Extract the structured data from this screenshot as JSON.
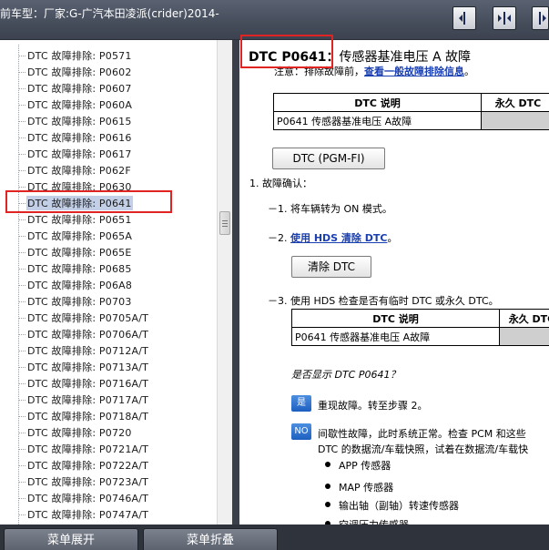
{
  "window": {
    "title": "前车型：厂家:G-广汽本田凌派(crider)2014-"
  },
  "toolbar": {
    "buttons": [
      "collapse-left-icon",
      "split-view-icon",
      "expand-right-icon"
    ]
  },
  "tree": {
    "items": [
      {
        "label": "DTC 故障排除: P0571",
        "selected": false
      },
      {
        "label": "DTC 故障排除: P0602",
        "selected": false
      },
      {
        "label": "DTC 故障排除: P0607",
        "selected": false
      },
      {
        "label": "DTC 故障排除: P060A",
        "selected": false
      },
      {
        "label": "DTC 故障排除: P0615",
        "selected": false
      },
      {
        "label": "DTC 故障排除: P0616",
        "selected": false
      },
      {
        "label": "DTC 故障排除: P0617",
        "selected": false
      },
      {
        "label": "DTC 故障排除: P062F",
        "selected": false
      },
      {
        "label": "DTC 故障排除: P0630",
        "selected": false
      },
      {
        "label": "DTC 故障排除: P0641",
        "selected": true
      },
      {
        "label": "DTC 故障排除: P0651",
        "selected": false
      },
      {
        "label": "DTC 故障排除: P065A",
        "selected": false
      },
      {
        "label": "DTC 故障排除: P065E",
        "selected": false
      },
      {
        "label": "DTC 故障排除: P0685",
        "selected": false
      },
      {
        "label": "DTC 故障排除: P06A8",
        "selected": false
      },
      {
        "label": "DTC 故障排除: P0703",
        "selected": false
      },
      {
        "label": "DTC 故障排除: P0705A/T",
        "selected": false
      },
      {
        "label": "DTC 故障排除: P0706A/T",
        "selected": false
      },
      {
        "label": "DTC 故障排除: P0712A/T",
        "selected": false
      },
      {
        "label": "DTC 故障排除: P0713A/T",
        "selected": false
      },
      {
        "label": "DTC 故障排除: P0716A/T",
        "selected": false
      },
      {
        "label": "DTC 故障排除: P0717A/T",
        "selected": false
      },
      {
        "label": "DTC 故障排除: P0718A/T",
        "selected": false
      },
      {
        "label": "DTC 故障排除: P0720",
        "selected": false
      },
      {
        "label": "DTC 故障排除: P0721A/T",
        "selected": false
      },
      {
        "label": "DTC 故障排除: P0722A/T",
        "selected": false
      },
      {
        "label": "DTC 故障排除: P0723A/T",
        "selected": false
      },
      {
        "label": "DTC 故障排除: P0746A/T",
        "selected": false
      },
      {
        "label": "DTC 故障排除: P0747A/T",
        "selected": false
      }
    ]
  },
  "doc": {
    "title_code": "DTC P0641：",
    "title_desc": "传感器基准电压 A 故障",
    "note_prefix": "注意：排除故障前，",
    "note_link": "查看一般故障排除信息",
    "note_suffix": "。",
    "table1": {
      "headers": [
        "DTC 说明",
        "永久 DTC"
      ],
      "rows": [
        [
          "P0641 传感器基准电压 A故障",
          ""
        ]
      ]
    },
    "pgm_button": "DTC (PGM-FI)",
    "step1": "1.  故障确认：",
    "step1_1": "－1. 将车辆转为 ON 模式。",
    "step1_2_prefix": "－2. ",
    "step1_2_link": "使用 HDS 清除 DTC",
    "step1_2_suffix": "。",
    "clear_button": "清除 DTC",
    "step1_3": "－3. 使用 HDS 检查是否有临时 DTC 或永久 DTC。",
    "table2": {
      "headers": [
        "DTC 说明",
        "永久 DTC"
      ],
      "rows": [
        [
          "P0641 传感器基准电压 A故障",
          ""
        ]
      ]
    },
    "question": "是否显示 DTC P0641？",
    "yes_tag": "是",
    "yes_text": "重现故障。转至步骤 2。",
    "no_tag": "NO",
    "no_text_line1": "间歇性故障，此时系统正常。检查 PCM 和这些",
    "no_text_line2": "DTC 的数据流/车载快照，试着在数据流/车载快",
    "bullets": [
      "APP 传感器",
      "MAP 传感器",
      "输出轴（副轴）转速传感器",
      "空调压力传感器"
    ]
  },
  "bottom": {
    "expand_label": "菜单展开",
    "collapse_label": "菜单折叠"
  }
}
